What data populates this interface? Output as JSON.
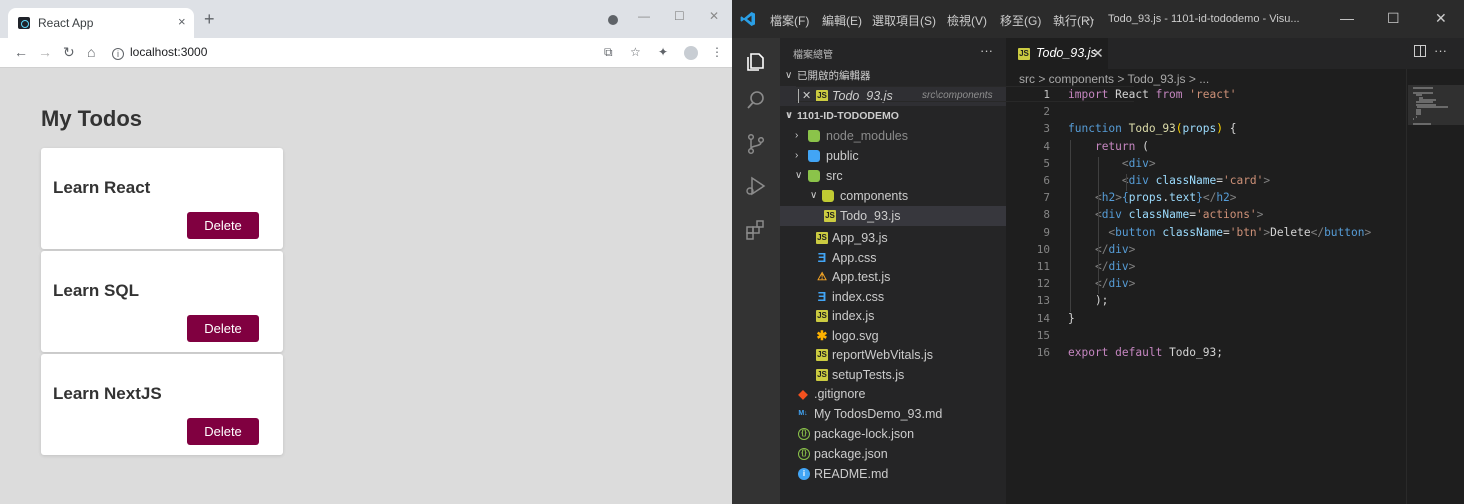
{
  "browser": {
    "tab_title": "React App",
    "tab_close": "×",
    "new_tab": "+",
    "url": "localhost:3000",
    "info": "i"
  },
  "app": {
    "heading": "My Todos",
    "todos": [
      {
        "title": "Learn React",
        "button": "Delete"
      },
      {
        "title": "Learn SQL",
        "button": "Delete"
      },
      {
        "title": "Learn NextJS",
        "button": "Delete"
      }
    ],
    "accent_color": "#800040"
  },
  "vscode": {
    "menus": [
      "檔案(F)",
      "編輯(E)",
      "選取項目(S)",
      "檢視(V)",
      "移至(G)",
      "執行(R)",
      "···"
    ],
    "window_title": "Todo_93.js - 1101-id-tododemo - Visu...",
    "sidebar_header": "檔案總管",
    "sidebar_more": "···",
    "open_editors_label": "已開啟的編輯器",
    "open_file": "Todo_93.js",
    "open_file_path": "src\\components",
    "project_label": "1101-ID-TODODEMO",
    "tree": [
      {
        "label": "node_modules",
        "icon": "folder-green-icon"
      },
      {
        "label": "public",
        "icon": "folder-blue-icon"
      },
      {
        "label": "src",
        "icon": "folder-src-icon"
      },
      {
        "label": "components",
        "icon": "folder-components-icon"
      },
      {
        "label": "Todo_93.js",
        "icon": "js-icon"
      },
      {
        "label": "App_93.js",
        "icon": "js-icon"
      },
      {
        "label": "App.css",
        "icon": "css-icon"
      },
      {
        "label": "App.test.js",
        "icon": "test-icon"
      },
      {
        "label": "index.css",
        "icon": "css-icon"
      },
      {
        "label": "index.js",
        "icon": "js-icon"
      },
      {
        "label": "logo.svg",
        "icon": "svg-icon"
      },
      {
        "label": "reportWebVitals.js",
        "icon": "js-icon"
      },
      {
        "label": "setupTests.js",
        "icon": "js-icon"
      },
      {
        "label": ".gitignore",
        "icon": "git-icon"
      },
      {
        "label": "My TodosDemo_93.md",
        "icon": "markdown-icon"
      },
      {
        "label": "package-lock.json",
        "icon": "json-icon"
      },
      {
        "label": "package.json",
        "icon": "json-icon"
      },
      {
        "label": "README.md",
        "icon": "info-icon"
      }
    ],
    "editor_tab": "Todo_93.js",
    "breadcrumb": "src > components > Todo_93.js > ...",
    "code": [
      "import React from 'react'",
      "",
      "function Todo_93(props) {",
      "    return (",
      "        <div>",
      "        <div className='card'>",
      "    <h2>{props.text}</h2>",
      "    <div className='actions'>",
      "      <button className='btn'>Delete</button>",
      "    </div>",
      "    </div>",
      "    </div>",
      "    );",
      "}",
      "",
      "export default Todo_93;"
    ]
  }
}
